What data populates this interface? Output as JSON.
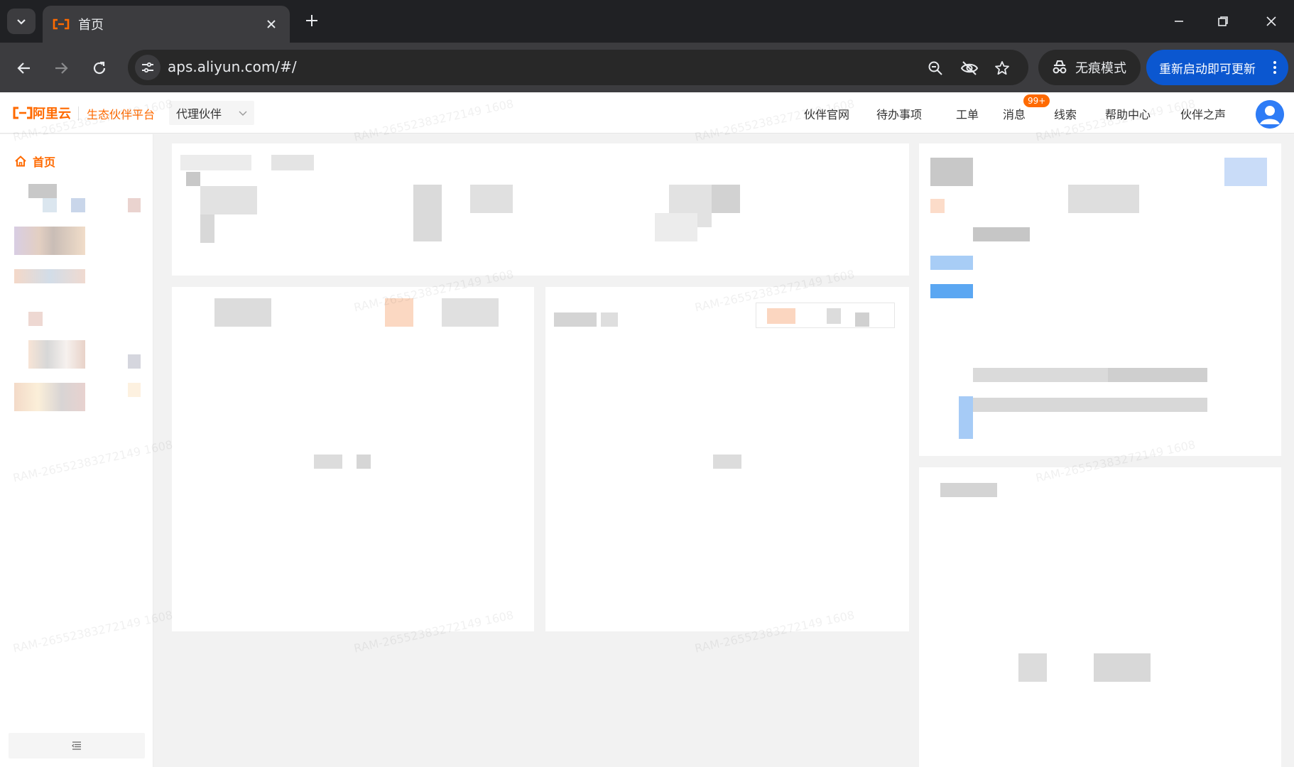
{
  "browser": {
    "tab_title": "首页",
    "url": "aps.aliyun.com/#/",
    "incognito_label": "无痕模式",
    "update_label": "重新启动即可更新"
  },
  "header": {
    "logo_text": "阿里云",
    "platform": "生态伙伴平台",
    "role": "代理伙伴",
    "nav": [
      {
        "label": "伙伴官网"
      },
      {
        "label": "待办事项"
      },
      {
        "label": "工单"
      },
      {
        "label": "消息"
      },
      {
        "label": "线索"
      },
      {
        "label": "帮助中心"
      },
      {
        "label": "伙伴之声"
      }
    ],
    "message_badge": "99+"
  },
  "sidebar": {
    "home_label": "首页"
  },
  "watermark": "RAM-26552383272149 1608",
  "colors": {
    "brand": "#ff6a00",
    "chrome_dark": "#202124",
    "chrome_toolbar": "#3c3c3f",
    "update_blue": "#0b57d0"
  },
  "icons": [
    "tab-search-icon",
    "aliyun-favicon",
    "close-icon",
    "plus-icon",
    "minimize-icon",
    "restore-icon",
    "back-arrow-icon",
    "forward-arrow-icon",
    "reload-icon",
    "site-settings-icon",
    "zoom-icon",
    "eye-off-icon",
    "star-icon",
    "incognito-icon",
    "more-vert-icon",
    "chevron-down-icon",
    "home-icon",
    "avatar-icon",
    "menu-collapse-icon"
  ]
}
